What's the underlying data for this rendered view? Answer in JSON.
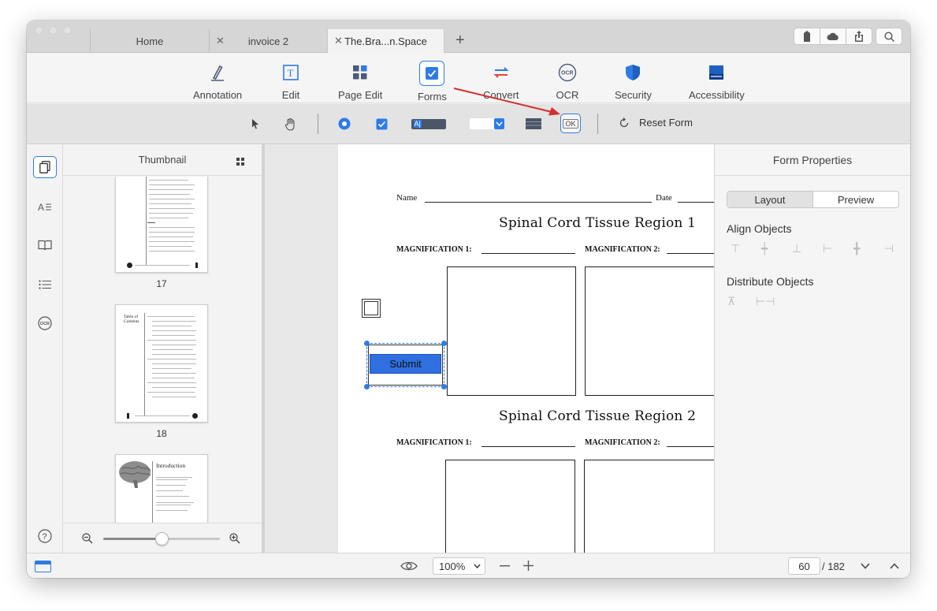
{
  "tabs": [
    {
      "label": "Home",
      "closable": false
    },
    {
      "label": "invoice 2",
      "closable": true
    },
    {
      "label": "The.Bra...n.Space",
      "closable": true,
      "active": true
    }
  ],
  "new_tab_symbol": "+",
  "main_tools": [
    {
      "label": "Annotation",
      "icon": "pen-icon"
    },
    {
      "label": "Edit",
      "icon": "text-edit-icon"
    },
    {
      "label": "Page Edit",
      "icon": "grid-icon"
    },
    {
      "label": "Forms",
      "icon": "checkbox-icon",
      "active": true
    },
    {
      "label": "Convert",
      "icon": "convert-arrows-icon"
    },
    {
      "label": "OCR",
      "icon": "ocr-icon"
    },
    {
      "label": "Security",
      "icon": "shield-icon"
    },
    {
      "label": "Accessibility",
      "icon": "accessibility-icon"
    }
  ],
  "form_tools": {
    "reset_label": "Reset Form",
    "button_field_label": "OK",
    "text_field_label": "A|"
  },
  "thumbnail_panel": {
    "title": "Thumbnail",
    "pages": [
      "17",
      "18"
    ],
    "page19_title": "Introduction",
    "page18_title": "Table of Contents"
  },
  "document": {
    "name_label": "Name",
    "date_label": "Date",
    "region1_title": "Spinal Cord Tissue Region 1",
    "region2_title": "Spinal Cord Tissue Region 2",
    "mag1_label": "MAGNIFICATION 1:",
    "mag2_label": "MAGNIFICATION 2:",
    "submit_label": "Submit"
  },
  "properties": {
    "title": "Form Properties",
    "tab_layout": "Layout",
    "tab_preview": "Preview",
    "align_label": "Align Objects",
    "distribute_label": "Distribute Objects"
  },
  "bottom": {
    "zoom": "100%",
    "current_page": "60",
    "total_pages": "/ 182"
  },
  "colors": {
    "accent": "#2e7be5",
    "submit_bg": "#2f6fe0",
    "arrow": "#d32f2f"
  }
}
